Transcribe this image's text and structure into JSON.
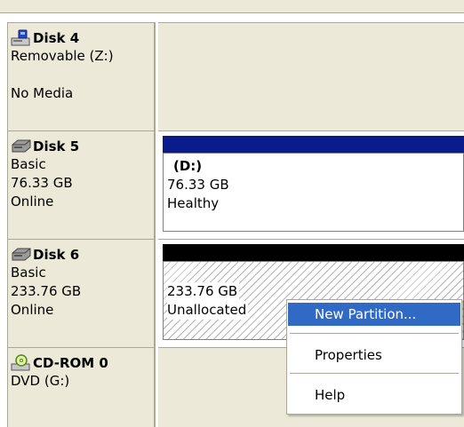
{
  "disks": [
    {
      "name": "Disk 4",
      "icon": "removable-disk-icon",
      "meta": [
        "Removable (Z:)",
        "",
        "No Media"
      ]
    },
    {
      "name": "Disk 5",
      "icon": "hard-disk-icon",
      "meta": [
        "Basic",
        "76.33 GB",
        "Online"
      ],
      "volume": {
        "letter": "(D:)",
        "size": "76.33 GB",
        "status": "Healthy",
        "bar_color": "#0a1c8c"
      }
    },
    {
      "name": "Disk 6",
      "icon": "hard-disk-icon",
      "meta": [
        "Basic",
        "233.76 GB",
        "Online"
      ],
      "volume": {
        "size": "233.76 GB",
        "status": "Unallocated",
        "bar_color": "#000000"
      }
    },
    {
      "name": "CD-ROM 0",
      "icon": "cd-rom-icon",
      "meta": [
        "DVD (G:)"
      ]
    }
  ],
  "context_menu": {
    "items": [
      "New Partition...",
      "Properties",
      "Help"
    ]
  },
  "colors": {
    "label_bg": "#ece9d8",
    "menu_highlight": "#316ac5",
    "primary_partition": "#0a1c8c"
  }
}
